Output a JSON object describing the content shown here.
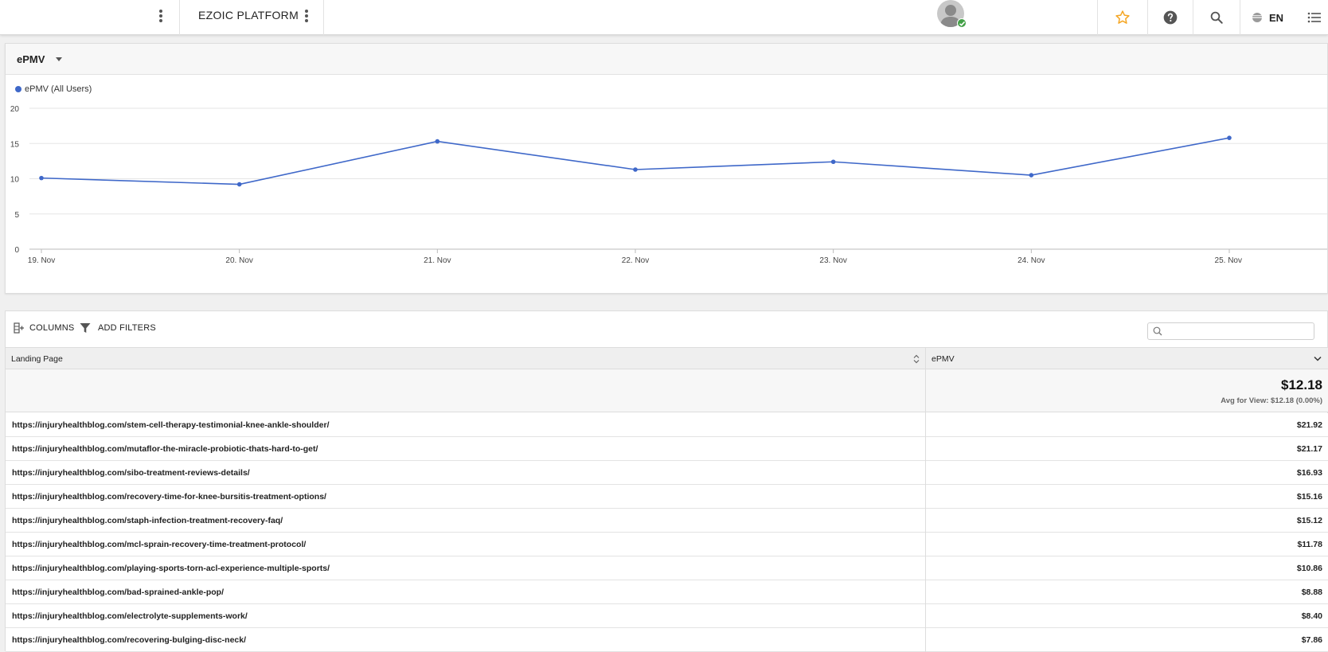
{
  "header": {
    "brand": "EZOIC PLATFORM",
    "language": "EN"
  },
  "chart_card": {
    "metric_label": "ePMV"
  },
  "chart_data": {
    "type": "line",
    "x": [
      "19. Nov",
      "20. Nov",
      "21. Nov",
      "22. Nov",
      "23. Nov",
      "24. Nov",
      "25. Nov"
    ],
    "series": [
      {
        "name": "ePMV (All Users)",
        "values": [
          10.1,
          9.2,
          15.3,
          11.3,
          12.4,
          10.5,
          15.8
        ]
      }
    ],
    "yticks": [
      "0",
      "5",
      "10",
      "15",
      "20"
    ],
    "ylim": [
      0,
      20
    ],
    "grid": true,
    "legend": "top-left",
    "color": "#3f68c9"
  },
  "table": {
    "toolbar": {
      "columns_label": "COLUMNS",
      "filters_label": "ADD FILTERS",
      "search_placeholder": ""
    },
    "columns": [
      "Landing Page",
      "ePMV"
    ],
    "summary": {
      "total": "$12.18",
      "avg": "Avg for View: $12.18  (0.00%)"
    },
    "rows": [
      {
        "page": "https://injuryhealthblog.com/stem-cell-therapy-testimonial-knee-ankle-shoulder/",
        "epmv": "$21.92"
      },
      {
        "page": "https://injuryhealthblog.com/mutaflor-the-miracle-probiotic-thats-hard-to-get/",
        "epmv": "$21.17"
      },
      {
        "page": "https://injuryhealthblog.com/sibo-treatment-reviews-details/",
        "epmv": "$16.93"
      },
      {
        "page": "https://injuryhealthblog.com/recovery-time-for-knee-bursitis-treatment-options/",
        "epmv": "$15.16"
      },
      {
        "page": "https://injuryhealthblog.com/staph-infection-treatment-recovery-faq/",
        "epmv": "$15.12"
      },
      {
        "page": "https://injuryhealthblog.com/mcl-sprain-recovery-time-treatment-protocol/",
        "epmv": "$11.78"
      },
      {
        "page": "https://injuryhealthblog.com/playing-sports-torn-acl-experience-multiple-sports/",
        "epmv": "$10.86"
      },
      {
        "page": "https://injuryhealthblog.com/bad-sprained-ankle-pop/",
        "epmv": "$8.88"
      },
      {
        "page": "https://injuryhealthblog.com/electrolyte-supplements-work/",
        "epmv": "$8.40"
      },
      {
        "page": "https://injuryhealthblog.com/recovering-bulging-disc-neck/",
        "epmv": "$7.86"
      }
    ]
  },
  "colors": {
    "accent": "#3f68c9",
    "star": "#f5a623",
    "online": "#43a047"
  }
}
